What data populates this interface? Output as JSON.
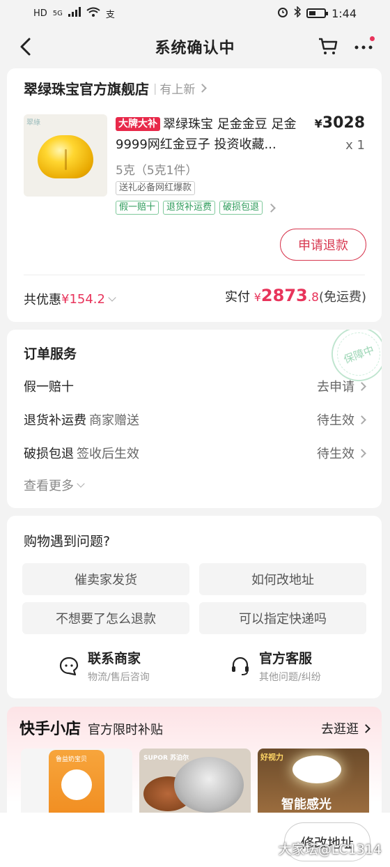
{
  "status_bar": {
    "network": "HD",
    "net_type": "5G",
    "extra": "支",
    "time": "1:44"
  },
  "nav": {
    "title": "系统确认中"
  },
  "store": {
    "name": "翠绿珠宝官方旗舰店",
    "new_link": "有上新",
    "product": {
      "image_label": "翠綠",
      "brand_tag": "大牌大补",
      "title": "翠绿珠宝 足金金豆 足金9999网红金豆子 投资收藏...",
      "price_symbol": "¥",
      "price": "3028",
      "qty": "x 1",
      "spec": "5克（5克1件）",
      "spec_tag": "送礼必备网红爆款",
      "service_tags": [
        "假一赔十",
        "退货补运费",
        "破损包退"
      ]
    },
    "refund_button": "申请退款",
    "discount_label": "共优惠",
    "discount_amount": "¥154.2",
    "paid_label": "实付",
    "paid_symbol": "¥",
    "paid_int": "2873",
    "paid_dec": ".8",
    "paid_note": "(免运费)"
  },
  "services": {
    "title": "订单服务",
    "stamp": "保障中",
    "rows": [
      {
        "name": "假一赔十",
        "sub": "",
        "status": "去申请"
      },
      {
        "name": "退货补运费",
        "sub": "商家赠送",
        "status": "待生效"
      },
      {
        "name": "破损包退",
        "sub": "签收后生效",
        "status": "待生效"
      }
    ],
    "more": "查看更多"
  },
  "help": {
    "title": "购物遇到问题?",
    "questions": [
      "催卖家发货",
      "如何改地址",
      "不想要了怎么退款",
      "可以指定快递吗"
    ],
    "contacts": [
      {
        "name": "联系商家",
        "sub": "物流/售后咨询"
      },
      {
        "name": "官方客服",
        "sub": "其他问题/纠纷"
      }
    ]
  },
  "shop": {
    "name": "快手小店",
    "subtitle": "官方限时补贴",
    "go": "去逛逛",
    "items": [
      {
        "label": "鲁益奶宝贝"
      },
      {
        "label": "SUPOR 苏泊尔"
      },
      {
        "label": "好视力",
        "text": "智能感光"
      }
    ]
  },
  "bottom": {
    "button": "修改地址"
  },
  "watermark": "大家坛@LC1314",
  "colors": {
    "accent": "#e8345b",
    "green": "#2d9b5a"
  }
}
